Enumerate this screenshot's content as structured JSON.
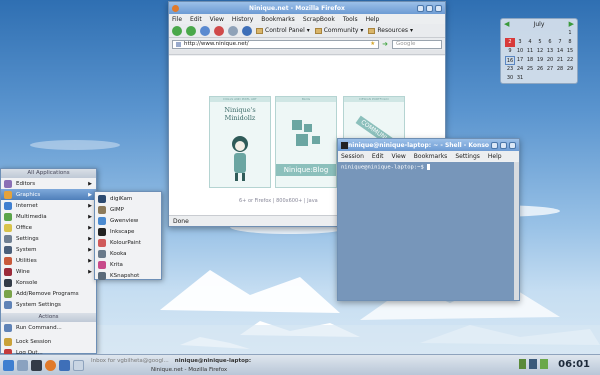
{
  "firefox": {
    "title": "Ninique.net - Mozilla Firefox",
    "menus": [
      "File",
      "Edit",
      "View",
      "History",
      "Bookmarks",
      "ScrapBook",
      "Tools",
      "Help"
    ],
    "bookmarks": [
      "Control Panel",
      "Community",
      "Resources"
    ],
    "url": "http://www.ninique.net/",
    "search_placeholder": "Google",
    "status": "Done",
    "page": {
      "card1_head": "DOLLS AND PIXEL ART",
      "card1_title": "Ninique's Minidollz",
      "card2_head": "BLOG",
      "card2_title": "Ninique:Blog",
      "card3_head": "DESIGN PORTFOLIO",
      "card3_title": "COMMUNI",
      "footer": "6+ or Firefox | 800x600+ | Java"
    }
  },
  "konsole": {
    "title": "ninique@ninique-laptop: ~ - Shell - Konsole",
    "menus": [
      "Session",
      "Edit",
      "View",
      "Bookmarks",
      "Settings",
      "Help"
    ],
    "prompt": "ninique@ninique-laptop:~$"
  },
  "calendar": {
    "month": "July",
    "days": [
      "",
      "",
      "",
      "",
      "",
      "",
      "1",
      "2",
      "3",
      "4",
      "5",
      "6",
      "7",
      "8",
      "9",
      "10",
      "11",
      "12",
      "13",
      "14",
      "15",
      "16",
      "17",
      "18",
      "19",
      "20",
      "21",
      "22",
      "23",
      "24",
      "25",
      "26",
      "27",
      "28",
      "29",
      "30",
      "31"
    ],
    "today": "2",
    "selected": "16"
  },
  "kmenu": {
    "header": "All Applications",
    "items": [
      {
        "label": "Editors",
        "icon": "editor-icon",
        "color": "#8a6fb5",
        "sub": true
      },
      {
        "label": "Graphics",
        "icon": "graphics-icon",
        "color": "#e4a23b",
        "sub": true
      },
      {
        "label": "Internet",
        "icon": "internet-icon",
        "color": "#3f7fd0",
        "sub": true
      },
      {
        "label": "Multimedia",
        "icon": "multimedia-icon",
        "color": "#5aa44a",
        "sub": true
      },
      {
        "label": "Office",
        "icon": "office-icon",
        "color": "#d8c34a",
        "sub": true
      },
      {
        "label": "Settings",
        "icon": "settings-icon",
        "color": "#6f7f92",
        "sub": true
      },
      {
        "label": "System",
        "icon": "system-icon",
        "color": "#4a5f7a",
        "sub": true
      },
      {
        "label": "Utilities",
        "icon": "utilities-icon",
        "color": "#c85a3b",
        "sub": true
      },
      {
        "label": "Wine",
        "icon": "wine-icon",
        "color": "#9b2b3a",
        "sub": true
      },
      {
        "label": "Konsole",
        "icon": "konsole-icon",
        "color": "#333b47",
        "sub": false
      },
      {
        "label": "Add/Remove Programs",
        "icon": "package-icon",
        "color": "#7aa34a",
        "sub": false
      },
      {
        "label": "System Settings",
        "icon": "system-settings-icon",
        "color": "#5f83b7",
        "sub": false
      }
    ],
    "actions_header": "Actions",
    "actions": [
      {
        "label": "Run Command...",
        "icon": "run-icon",
        "color": "#5f83b7"
      },
      {
        "label": "Lock Session",
        "icon": "lock-icon",
        "color": "#caa23a"
      },
      {
        "label": "Log Out...",
        "icon": "logout-icon",
        "color": "#c33b3b"
      }
    ]
  },
  "graphics_submenu": [
    {
      "label": "digiKam",
      "icon": "digikam-icon",
      "color": "#2c4a70"
    },
    {
      "label": "GIMP",
      "icon": "gimp-icon",
      "color": "#8c7a5a"
    },
    {
      "label": "Gwenview",
      "icon": "gwenview-icon",
      "color": "#4a8ad0"
    },
    {
      "label": "Inkscape",
      "icon": "inkscape-icon",
      "color": "#222222"
    },
    {
      "label": "KolourPaint",
      "icon": "kolourpaint-icon",
      "color": "#d05a5a"
    },
    {
      "label": "Kooka",
      "icon": "kooka-icon",
      "color": "#6a7a8a"
    },
    {
      "label": "Krita",
      "icon": "krita-icon",
      "color": "#c84a8a"
    },
    {
      "label": "KSnapshot",
      "icon": "ksnapshot-icon",
      "color": "#5a6a7a"
    }
  ],
  "taskbar": {
    "tasks": [
      "Inbox for vgbilheta@googl...",
      "ninique@ninique-laptop:",
      "Ninique.net - Mozilla Firefox"
    ],
    "clock": "06:01"
  }
}
